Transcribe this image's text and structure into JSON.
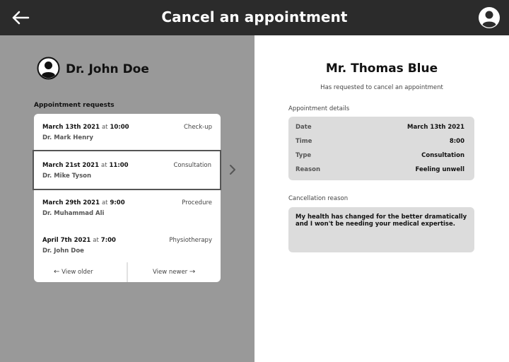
{
  "header": {
    "title": "Cancel an appointment",
    "back_icon": "arrow-left-icon",
    "avatar_icon": "user-avatar-icon",
    "background": "#2b2b2b"
  },
  "doctor": {
    "name": "Dr. John Doe",
    "avatar_icon": "user-avatar-icon"
  },
  "requests": {
    "title": "Appointment requests",
    "items": [
      {
        "date": "March 13th 2021",
        "at": "at",
        "time": "10:00",
        "doctor": "Dr. Mark Henry",
        "type": "Check-up",
        "selected": false
      },
      {
        "date": "March 21st 2021",
        "at": "at",
        "time": "11:00",
        "doctor": "Dr. Mike Tyson",
        "type": "Consultation",
        "selected": true
      },
      {
        "date": "March 29th 2021",
        "at": "at",
        "time": "9:00",
        "doctor": "Dr. Muhammad Ali",
        "type": "Procedure",
        "selected": false
      },
      {
        "date": "April 7th 2021",
        "at": "at",
        "time": "7:00",
        "doctor": "Dr. John Doe",
        "type": "Physiotherapy",
        "selected": false
      }
    ],
    "view_older": "View older",
    "view_newer": "View newer"
  },
  "patient": {
    "name": "Mr. Thomas Blue",
    "subtitle": "Has requested to cancel an appointment"
  },
  "details": {
    "label": "Appointment details",
    "rows": [
      {
        "key": "Date",
        "value": "March 13th 2021"
      },
      {
        "key": "Time",
        "value": "8:00"
      },
      {
        "key": "Type",
        "value": "Consultation"
      },
      {
        "key": "Reason",
        "value": "Feeling unwell"
      }
    ]
  },
  "cancellation": {
    "label": "Cancellation reason",
    "text": "My health has changed for the better dramatically and I won't be needing your medical expertise."
  },
  "colors": {
    "left_panel": "#999999",
    "box_fill": "#dcdcdc"
  }
}
